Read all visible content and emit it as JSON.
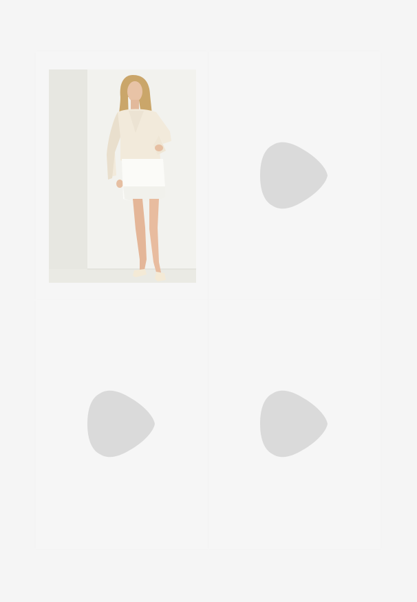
{
  "grid": {
    "items": [
      {
        "kind": "image",
        "icon": "product-photo",
        "alt": ""
      },
      {
        "kind": "placeholder",
        "icon": "play-placeholder-icon"
      },
      {
        "kind": "placeholder",
        "icon": "play-placeholder-icon"
      },
      {
        "kind": "placeholder",
        "icon": "play-placeholder-icon"
      }
    ]
  },
  "colors": {
    "background": "#f5f5f5",
    "placeholder_icon": "#dadada"
  }
}
